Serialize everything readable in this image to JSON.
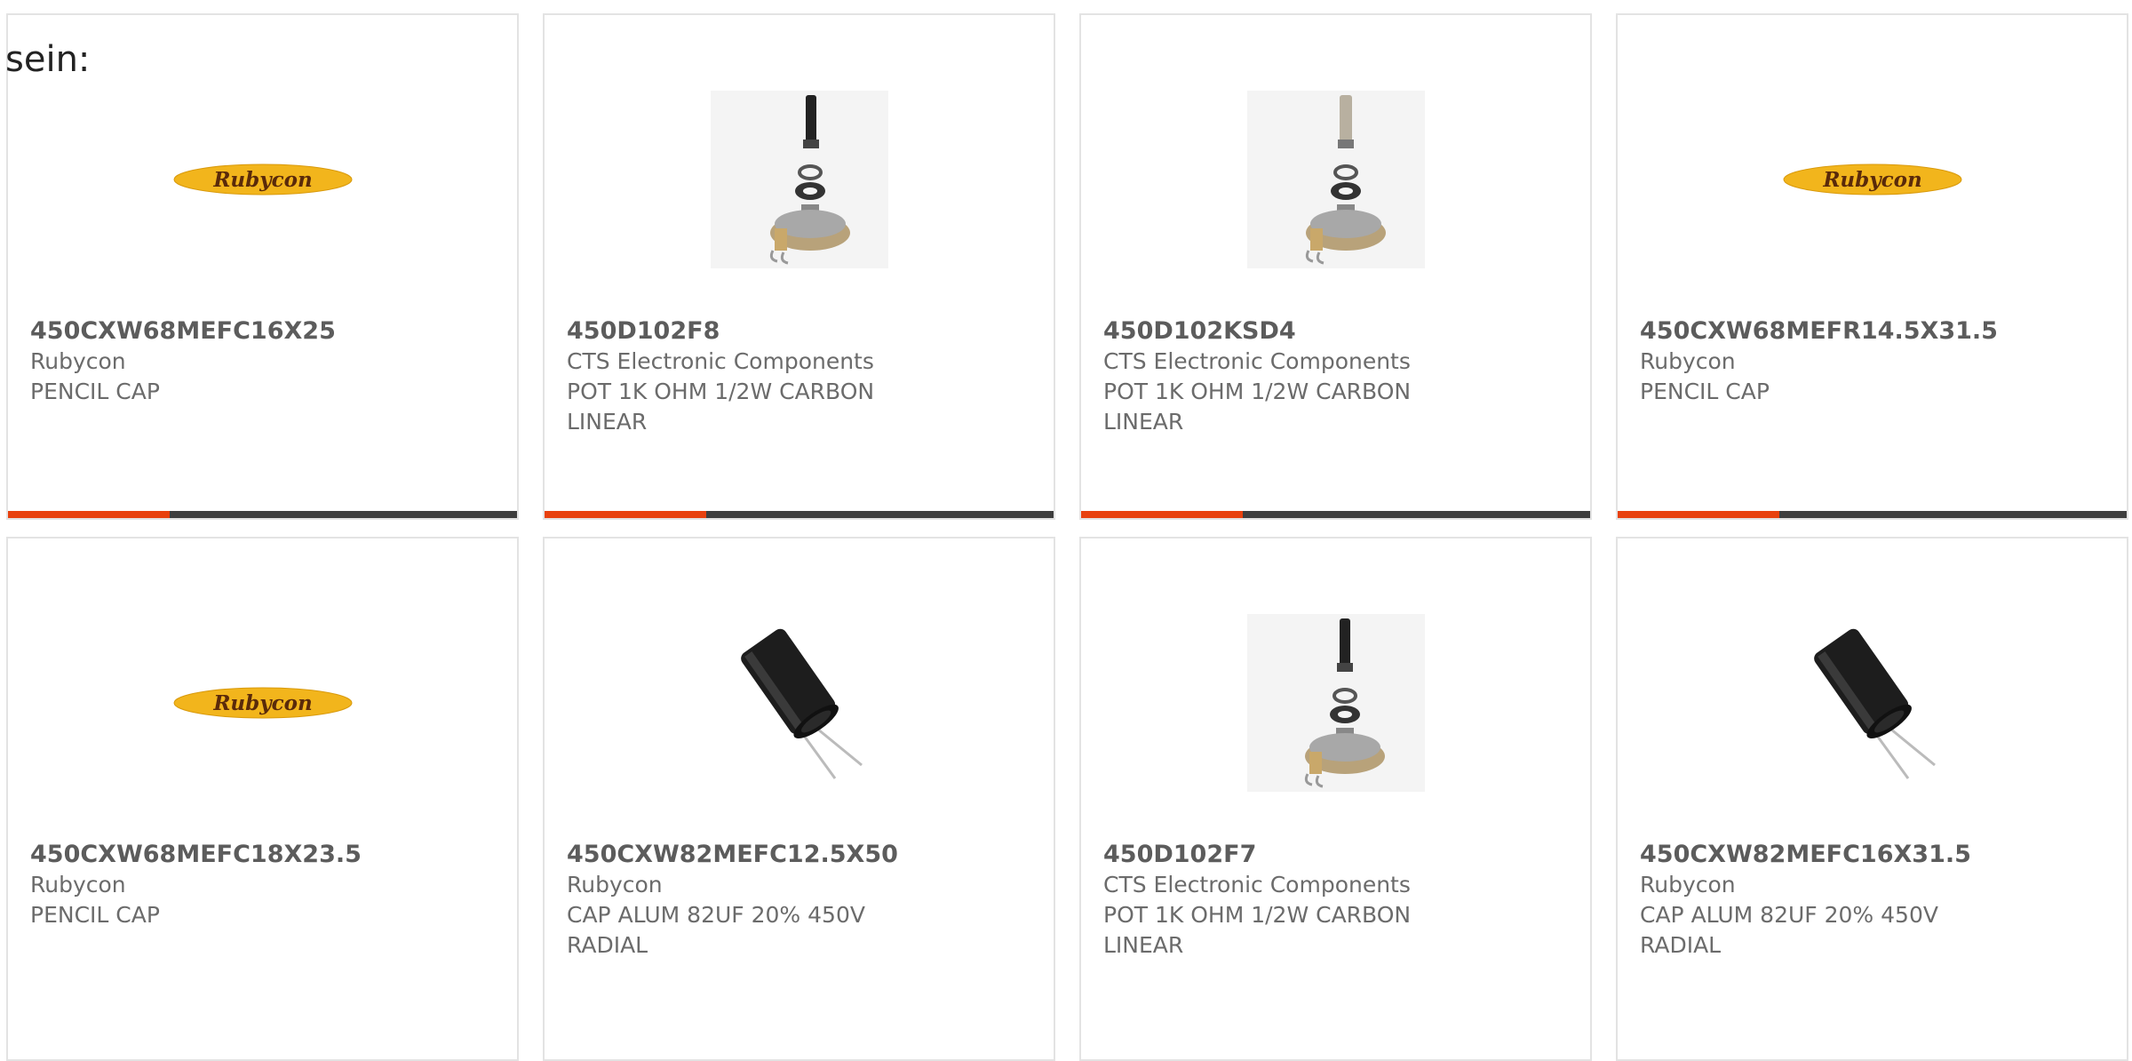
{
  "intro_text": "sein:",
  "products": [
    {
      "part": "450CXW68MEFC16X25",
      "maker": "Rubycon",
      "desc": "PENCIL CAP",
      "image": "rubycon-logo"
    },
    {
      "part": "450D102F8",
      "maker": "CTS Electronic Components",
      "desc": "POT 1K OHM 1/2W CARBON LINEAR",
      "image": "potentiometer-dark-shaft"
    },
    {
      "part": "450D102KSD4",
      "maker": "CTS Electronic Components",
      "desc": "POT 1K OHM 1/2W CARBON LINEAR",
      "image": "potentiometer-light-shaft"
    },
    {
      "part": "450CXW68MEFR14.5X31.5",
      "maker": "Rubycon",
      "desc": "PENCIL CAP",
      "image": "rubycon-logo"
    },
    {
      "part": "450CXW68MEFC18X23.5",
      "maker": "Rubycon",
      "desc": "PENCIL CAP",
      "image": "rubycon-logo"
    },
    {
      "part": "450CXW82MEFC12.5X50",
      "maker": "Rubycon",
      "desc": "CAP ALUM 82UF 20% 450V RADIAL",
      "image": "electrolytic-capacitor"
    },
    {
      "part": "450D102F7",
      "maker": "CTS Electronic Components",
      "desc": "POT 1K OHM 1/2W CARBON LINEAR",
      "image": "potentiometer-dark-shaft"
    },
    {
      "part": "450CXW82MEFC16X31.5",
      "maker": "Rubycon",
      "desc": "CAP ALUM 82UF 20% 450V RADIAL",
      "image": "electrolytic-capacitor"
    }
  ],
  "logo_text": "Rubycon",
  "colors": {
    "accent": "#e8410e",
    "bar": "#3e3e3e",
    "border": "#e3e3e3",
    "logo_yellow": "#f2b51c"
  }
}
